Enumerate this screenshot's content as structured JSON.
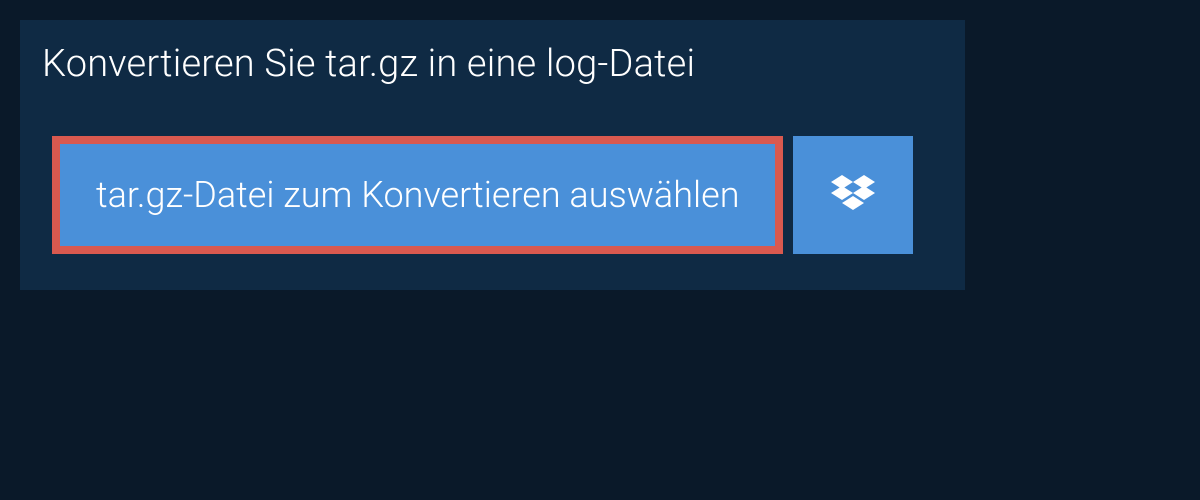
{
  "title": "Konvertieren Sie tar.gz in eine log-Datei",
  "select_file_label": "tar.gz-Datei zum Konvertieren auswählen",
  "colors": {
    "page_bg": "#0a1929",
    "panel_bg": "#0f2a44",
    "button_bg": "#4a90d9",
    "highlight_border": "#d9594f"
  }
}
